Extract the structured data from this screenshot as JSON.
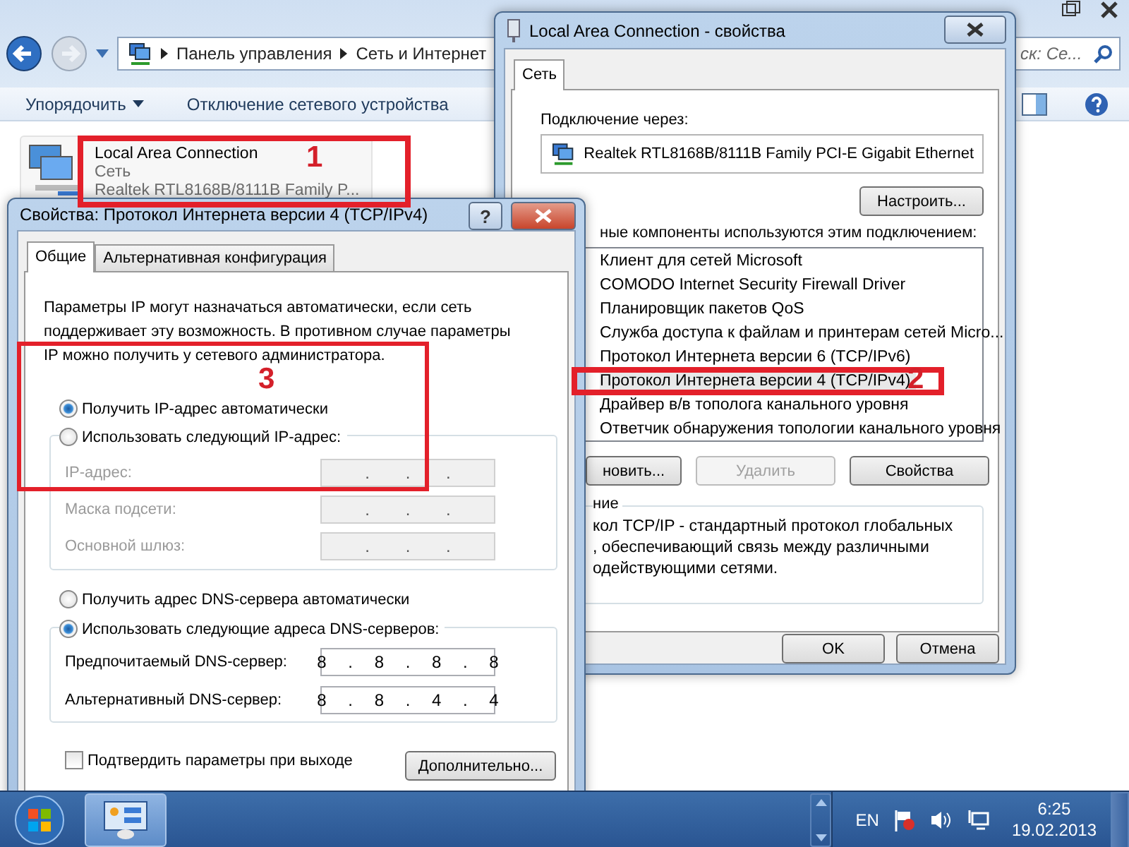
{
  "explorer": {
    "breadcrumbs": [
      "Панель управления",
      "Сеть и Интернет"
    ],
    "search": {
      "placeholder": "ск: Се..."
    },
    "toolbar": [
      {
        "kind": "menu",
        "label": "Упорядочить"
      },
      {
        "kind": "command",
        "label": "Отключение сетевого устройства"
      }
    ],
    "connection": {
      "name": "Local Area Connection",
      "network": "Сеть",
      "adapter": "Realtek RTL8168B/8111B Family P..."
    }
  },
  "properties": {
    "title": "Local Area Connection - свойства",
    "tabs": [
      {
        "label": "Сеть",
        "selected": true
      }
    ],
    "connect_label": "Подключение через:",
    "adapter": "Realtek RTL8168B/8111B Family PCI-E Gigabit Ethernet",
    "configure_button": "Настроить...",
    "components_label": "ные компоненты используются этим подключением:",
    "components": [
      {
        "label": "Клиент для сетей Microsoft",
        "selected": false
      },
      {
        "label": "COMODO Internet Security Firewall Driver",
        "selected": false
      },
      {
        "label": "Планировщик пакетов QoS",
        "selected": false
      },
      {
        "label": "Служба доступа к файлам и принтерам сетей Micro...",
        "selected": false
      },
      {
        "label": "Протокол Интернета версии 6 (TCP/IPv6)",
        "selected": false
      },
      {
        "label": "Протокол Интернета версии 4 (TCP/IPv4)",
        "selected": true
      },
      {
        "label": "Драйвер в/в тополога канального уровня",
        "selected": false
      },
      {
        "label": "Ответчик обнаружения топологии канального уровня",
        "selected": false
      }
    ],
    "actions": [
      {
        "label": "новить...",
        "disabled": false
      },
      {
        "label": "Удалить",
        "disabled": true
      },
      {
        "label": "Свойства",
        "disabled": false
      }
    ],
    "description": {
      "legend": "ние",
      "lines": [
        "кол TCP/IP - стандартный протокол глобальных",
        ", обеспечивающий связь между различными",
        "одействующими сетями."
      ]
    },
    "buttons": [
      "OK",
      "Отмена"
    ]
  },
  "ipv4": {
    "title": "Свойства: Протокол Интернета версии 4 (TCP/IPv4)",
    "help": "?",
    "tabs": [
      {
        "label": "Общие",
        "selected": true
      },
      {
        "label": "Альтернативная конфигурация",
        "selected": false
      }
    ],
    "intro": "Параметры IP могут назначаться автоматически, если сеть поддерживает эту возможность. В противном случае параметры IP можно получить у сетевого администратора.",
    "ip_mode": [
      {
        "label": "Получить IP-адрес автоматически",
        "selected": true
      },
      {
        "label": "Использовать следующий IP-адрес:",
        "selected": false
      }
    ],
    "ip_fields": [
      {
        "label": "IP-адрес:",
        "value": ". . .",
        "disabled": true
      },
      {
        "label": "Маска подсети:",
        "value": ". . .",
        "disabled": true
      },
      {
        "label": "Основной шлюз:",
        "value": ". . .",
        "disabled": true
      }
    ],
    "dns_mode": [
      {
        "label": "Получить адрес DNS-сервера автоматически",
        "selected": false
      },
      {
        "label": "Использовать следующие адреса DNS-серверов:",
        "selected": true
      }
    ],
    "dns_fields": [
      {
        "label": "Предпочитаемый DNS-сервер:",
        "value": "8 . 8 . 8 . 8",
        "disabled": false
      },
      {
        "label": "Альтернативный DNS-сервер:",
        "value": "8 . 8 . 4 . 4",
        "disabled": false
      }
    ],
    "confirm": {
      "label": "Подтвердить параметры при выходе",
      "checked": false
    },
    "advanced_button": "Дополнительно..."
  },
  "annotations": [
    "1",
    "2",
    "3"
  ],
  "taskbar": {
    "language": "EN",
    "time": "6:25",
    "date": "19.02.2013"
  }
}
